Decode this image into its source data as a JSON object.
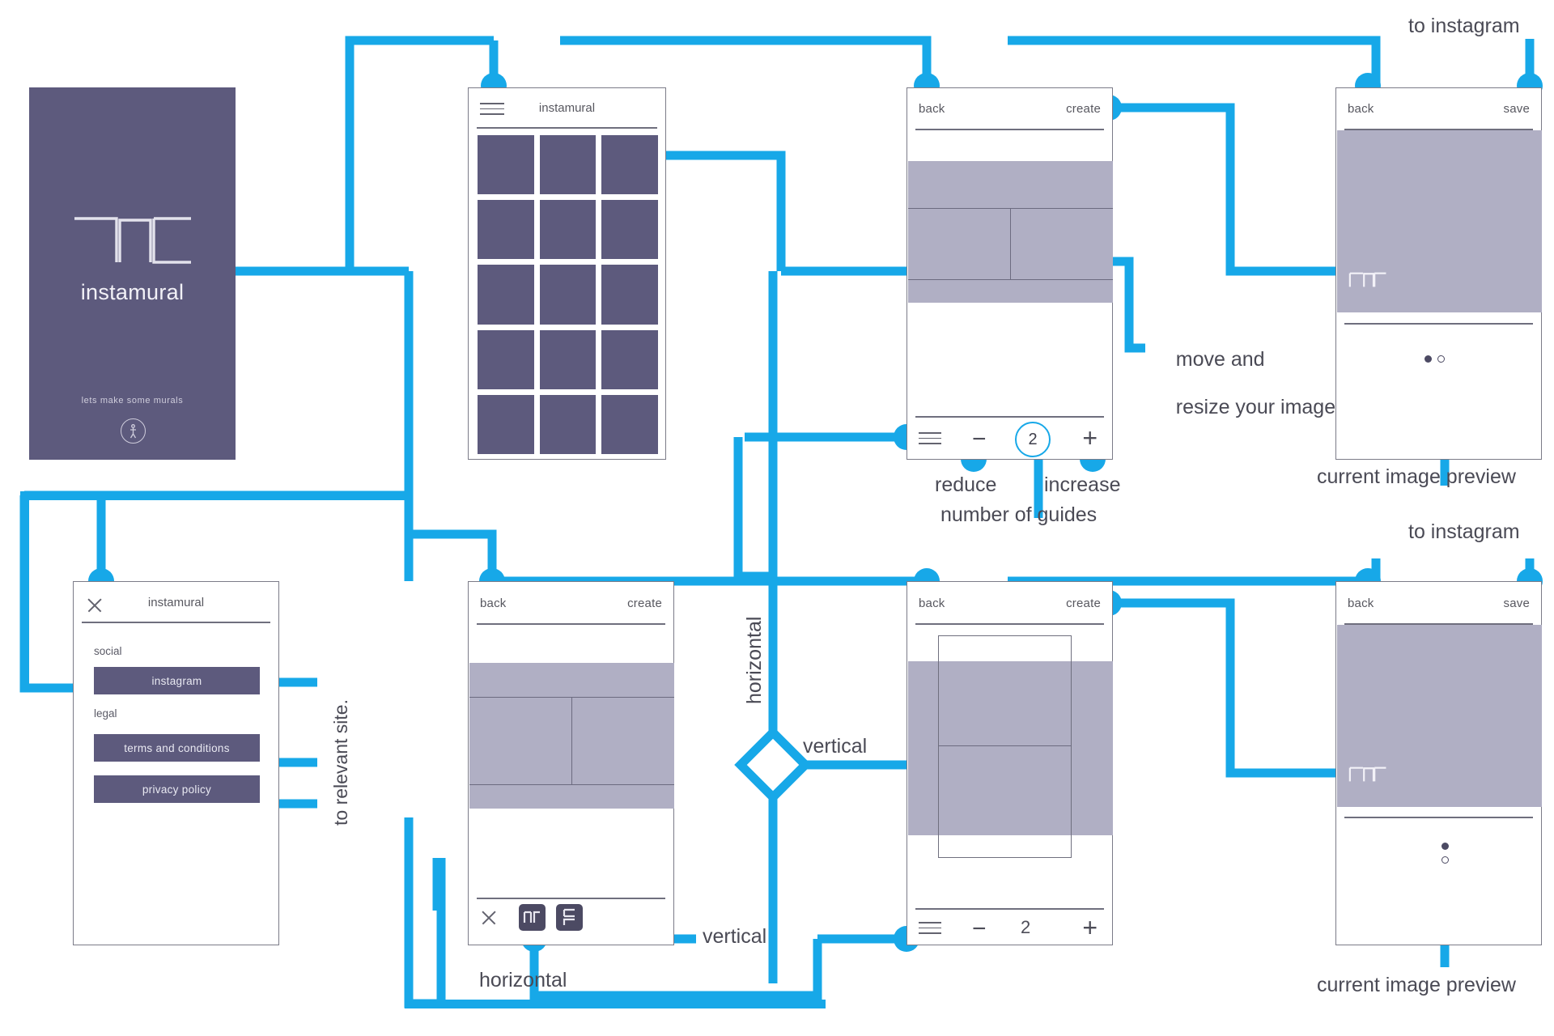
{
  "meta": {
    "accent": "#17a8e8",
    "brand_purple": "#5d5a7d",
    "image_gray": "#b0afc4"
  },
  "splash": {
    "title": "instamural",
    "tagline": "lets make some murals",
    "badge_icon": "walking-person-icon"
  },
  "grid_screen": {
    "menu_icon": "hamburger-icon",
    "title": "instamural",
    "rows": 5,
    "cols": 3
  },
  "menu_screen": {
    "close_icon": "close-icon",
    "title": "instamural",
    "sections": [
      {
        "label": "social",
        "items": [
          "instagram"
        ]
      },
      {
        "label": "legal",
        "items": [
          "terms and conditions",
          "privacy policy"
        ]
      }
    ],
    "annotation": "to relevant site."
  },
  "editor_horizontal": {
    "back_label": "back",
    "create_label": "create",
    "guides": {
      "menu_icon": "hamburger-icon",
      "reduce_icon": "minus-icon",
      "count": "2",
      "increase_icon": "plus-icon"
    },
    "annotations": {
      "reduce": "reduce",
      "increase": "increase",
      "count": "number of guides",
      "resize": "move and\nresize your image"
    }
  },
  "editor_choose": {
    "back_label": "back",
    "create_label": "create",
    "close_icon": "close-icon",
    "orientation_buttons": [
      {
        "icon": "orientation-horizontal-icon",
        "label": "horizontal"
      },
      {
        "icon": "orientation-vertical-icon",
        "label": "vertical"
      }
    ]
  },
  "editor_vertical": {
    "back_label": "back",
    "create_label": "create",
    "guides": {
      "menu_icon": "hamburger-icon",
      "reduce_icon": "minus-icon",
      "count": "2",
      "increase_icon": "plus-icon"
    }
  },
  "save_screen_top": {
    "back_label": "back",
    "save_label": "save",
    "destination": "to instagram",
    "preview_caption": "current image preview",
    "page_dots": [
      "active",
      "inactive"
    ]
  },
  "save_screen_bottom": {
    "back_label": "back",
    "save_label": "save",
    "destination": "to instagram",
    "preview_caption": "current image preview",
    "page_dots": [
      "active",
      "inactive"
    ]
  },
  "branch": {
    "horizontal_label": "horizontal",
    "vertical_label": "vertical",
    "vertical_toolbar_label": "vertical",
    "horizontal_toolbar_label": "horizontal"
  }
}
